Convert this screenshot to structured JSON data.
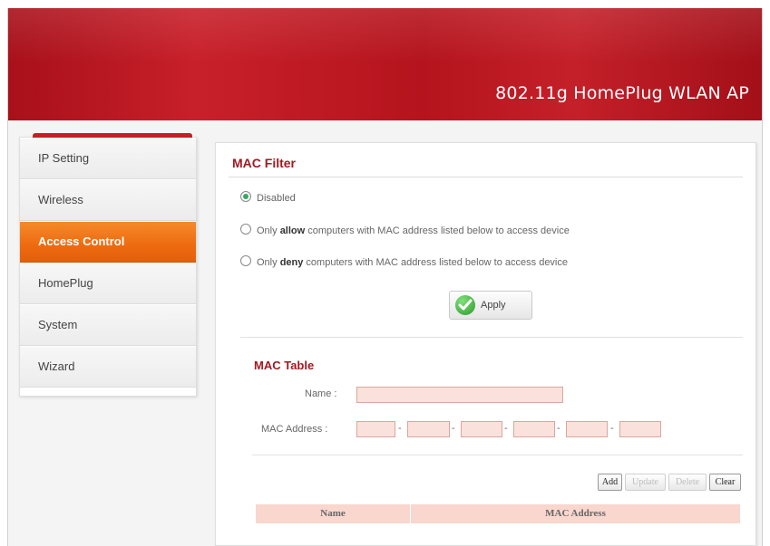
{
  "header": {
    "product_title": "802.11g HomePlug WLAN AP"
  },
  "sidebar": {
    "items": [
      {
        "label": "IP Setting",
        "active": false
      },
      {
        "label": "Wireless",
        "active": false
      },
      {
        "label": "Access Control",
        "active": true
      },
      {
        "label": "HomePlug",
        "active": false
      },
      {
        "label": "System",
        "active": false
      },
      {
        "label": "Wizard",
        "active": false
      }
    ]
  },
  "mac_filter": {
    "title": "MAC Filter",
    "options": [
      {
        "pre": "Disabled",
        "bold": "",
        "post": "",
        "selected": true
      },
      {
        "pre": "Only ",
        "bold": "allow",
        "post": " computers with MAC address listed below to access device",
        "selected": false
      },
      {
        "pre": "Only ",
        "bold": "deny",
        "post": " computers with MAC address listed below to access device",
        "selected": false
      }
    ],
    "apply_label": "Apply"
  },
  "mac_table": {
    "title": "MAC Table",
    "name_label": "Name :",
    "name_value": "",
    "mac_label": "MAC Address :",
    "mac_octets": [
      "",
      "",
      "",
      "",
      "",
      ""
    ],
    "buttons": {
      "add": "Add",
      "update": "Update",
      "delete": "Delete",
      "clear": "Clear"
    },
    "columns": [
      "Name",
      "MAC Address"
    ]
  },
  "colors": {
    "header_red": "#b5141d",
    "active_orange": "#ee6a10",
    "section_title": "#a01a22",
    "input_fill": "#fbe1dc",
    "table_header_fill": "#f9d6ce"
  }
}
